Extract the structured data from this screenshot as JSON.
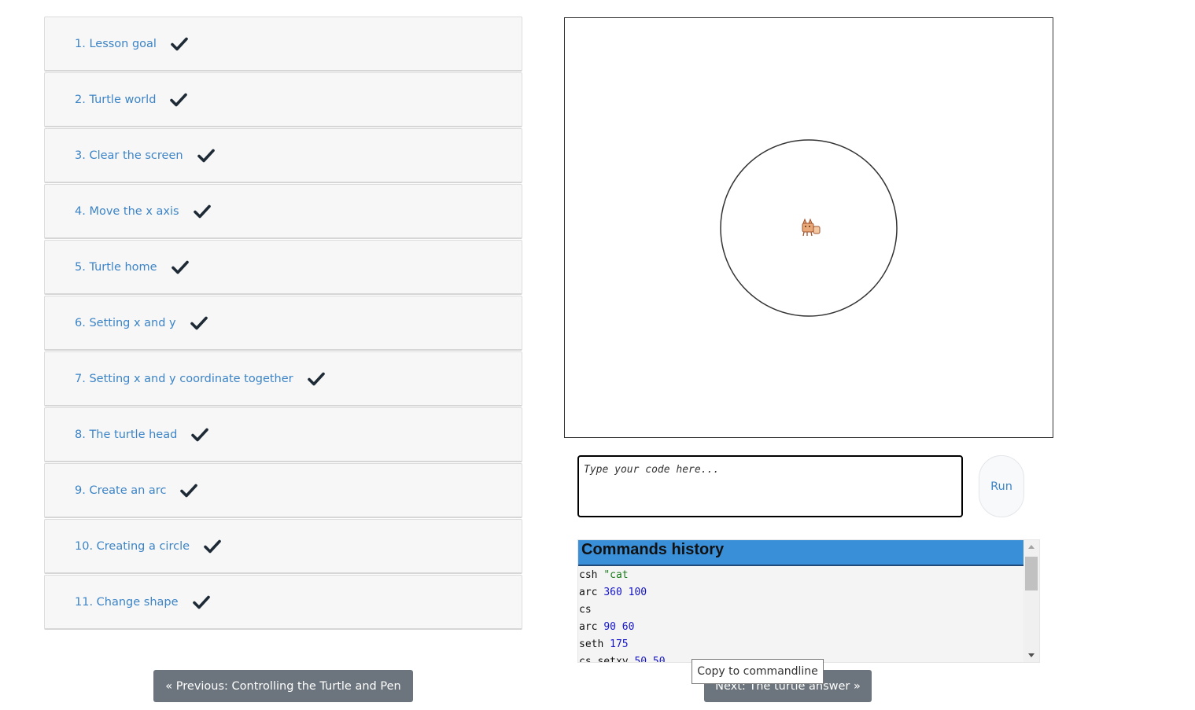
{
  "lessons": [
    {
      "label": "1. Lesson goal",
      "completed": true
    },
    {
      "label": "2. Turtle world",
      "completed": true
    },
    {
      "label": "3. Clear the screen",
      "completed": true
    },
    {
      "label": "4. Move the x axis",
      "completed": true
    },
    {
      "label": "5. Turtle home",
      "completed": true
    },
    {
      "label": "6. Setting x and y",
      "completed": true
    },
    {
      "label": "7. Setting x and y coordinate together",
      "completed": true
    },
    {
      "label": "8. The turtle head",
      "completed": true
    },
    {
      "label": "9. Create an arc",
      "completed": true
    },
    {
      "label": "10. Creating a circle",
      "completed": true
    },
    {
      "label": "11. Change shape",
      "completed": true
    }
  ],
  "editor": {
    "placeholder": "Type your code here...",
    "run_label": "Run"
  },
  "history": {
    "title": "Commands history",
    "lines": [
      [
        {
          "t": "cmd",
          "v": "csh "
        },
        {
          "t": "str",
          "v": "\"cat"
        }
      ],
      [
        {
          "t": "cmd",
          "v": "arc "
        },
        {
          "t": "num",
          "v": "360 100"
        }
      ],
      [
        {
          "t": "cmd",
          "v": "cs"
        }
      ],
      [
        {
          "t": "cmd",
          "v": "arc "
        },
        {
          "t": "num",
          "v": "90 60"
        }
      ],
      [
        {
          "t": "cmd",
          "v": "seth "
        },
        {
          "t": "num",
          "v": "175"
        }
      ],
      [
        {
          "t": "cmd",
          "v": "cs setxy "
        },
        {
          "t": "num",
          "v": "50 50"
        }
      ]
    ]
  },
  "tooltip": "Copy to commandline",
  "nav": {
    "prev_label": "« Previous: Controlling the Turtle and Pen",
    "next_label": "Next: The turtle answer »"
  },
  "colors": {
    "link": "#3c84c6",
    "history_header": "#3a8fd9",
    "nav_button": "#6c757d"
  }
}
